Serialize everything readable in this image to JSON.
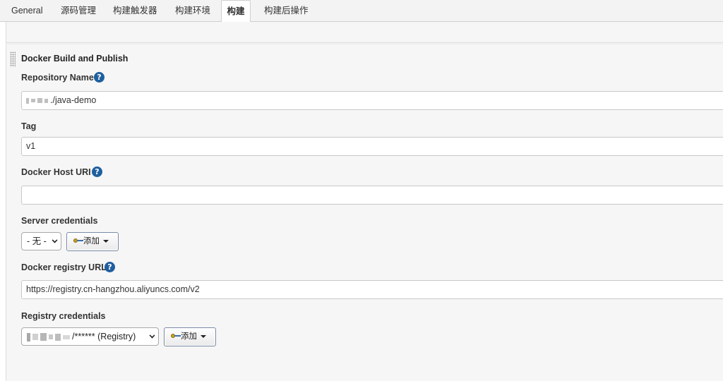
{
  "tabs": [
    {
      "label": "General",
      "active": false
    },
    {
      "label": "源码管理",
      "active": false
    },
    {
      "label": "构建触发器",
      "active": false
    },
    {
      "label": "构建环境",
      "active": false
    },
    {
      "label": "构建",
      "active": true
    },
    {
      "label": "构建后操作",
      "active": false
    }
  ],
  "section": {
    "title": "Docker Build and Publish"
  },
  "fields": {
    "repository_name": {
      "label": "Repository Name",
      "value": "./java-demo",
      "help": "?"
    },
    "tag": {
      "label": "Tag",
      "value": "v1"
    },
    "docker_host_uri": {
      "label": "Docker Host URI",
      "value": "",
      "help": "?"
    },
    "server_credentials": {
      "label": "Server credentials",
      "selected": "- 无 -",
      "add_label": "添加"
    },
    "docker_registry_url": {
      "label": "Docker registry URL",
      "value": "https://registry.cn-hangzhou.aliyuncs.com/v2",
      "help": "?"
    },
    "registry_credentials": {
      "label": "Registry credentials",
      "selected": "/****** (Registry)",
      "add_label": "添加"
    }
  },
  "colors": {
    "help_icon": "#1f5fa0",
    "panel_bg": "#f6f6f6",
    "tabbar_bg": "#f3f3f3"
  },
  "icons": [
    "help-icon",
    "key-icon",
    "dropdown-caret-icon",
    "drag-handle-icon"
  ]
}
